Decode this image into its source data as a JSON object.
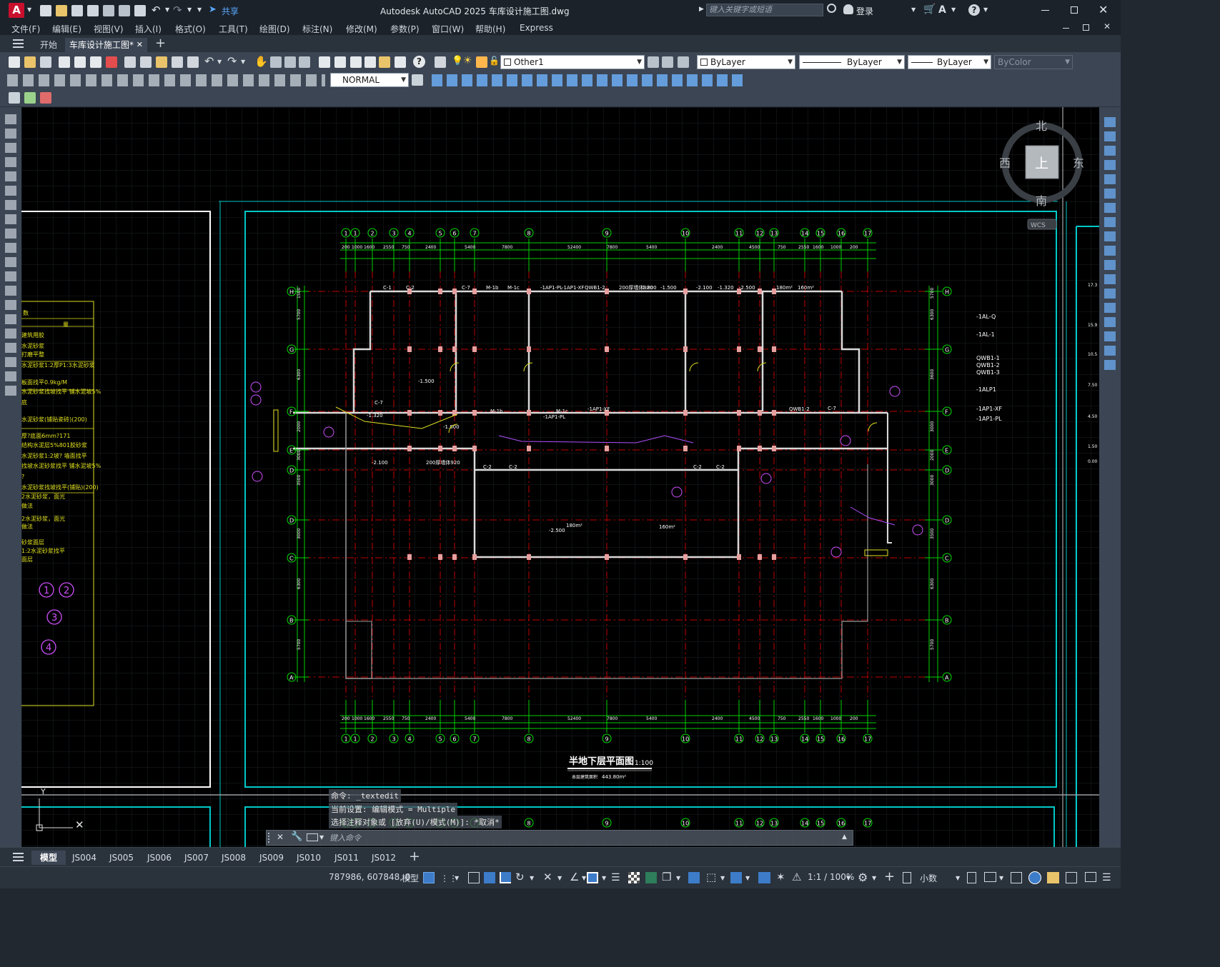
{
  "app": {
    "logo_letter": "A",
    "share_label": "共享",
    "title": "Autodesk AutoCAD 2025    车库设计施工图.dwg",
    "search_placeholder": "键入关键字或短语",
    "login_label": "登录"
  },
  "menus": [
    "文件(F)",
    "编辑(E)",
    "视图(V)",
    "插入(I)",
    "格式(O)",
    "工具(T)",
    "绘图(D)",
    "标注(N)",
    "修改(M)",
    "参数(P)",
    "窗口(W)",
    "帮助(H)",
    "Express"
  ],
  "doc_tabs": {
    "start": "开始",
    "active": "车库设计施工图*"
  },
  "layers": {
    "current_layer": "Other1",
    "color": "ByLayer",
    "linetype": "ByLayer",
    "lineweight": "ByLayer",
    "plotstyle": "ByColor",
    "dimstyle": "NORMAL"
  },
  "viewcube": {
    "north": "北",
    "south": "南",
    "west": "西",
    "east": "东",
    "top": "上",
    "wcs": "WCS"
  },
  "drawing": {
    "title": "半地下层平面图",
    "scale": "1:100",
    "area_label": "本层建筑面积",
    "area_value": "443.80m²",
    "col_axes": [
      "1",
      "1",
      "2",
      "3",
      "4",
      "5",
      "6",
      "7",
      "8",
      "9",
      "10",
      "11",
      "12",
      "13",
      "14",
      "15",
      "16",
      "17"
    ],
    "row_axes": [
      "H",
      "G",
      "F",
      "E",
      "D",
      "D",
      "C",
      "B",
      "A"
    ],
    "top_dims": [
      "200",
      "1000",
      "1600",
      "2550",
      "750",
      "2400",
      "5400",
      "7800",
      "52400",
      "7800",
      "5400",
      "2400",
      "4500",
      "750",
      "2550",
      "1600",
      "1000",
      "200"
    ],
    "bottom_dims": [
      "200",
      "1000",
      "1600",
      "2550",
      "750",
      "2400",
      "5400",
      "7800",
      "52400",
      "7800",
      "5400",
      "2400",
      "4500",
      "750",
      "2550",
      "1600",
      "1000",
      "200"
    ],
    "left_dims": [
      "1500",
      "5700",
      "6300",
      "2000",
      "3000",
      "3500",
      "3000",
      "6300",
      "5700"
    ],
    "right_dims": [
      "5700",
      "6300",
      "3600",
      "3000",
      "2000",
      "3000",
      "3500",
      "6300",
      "5700"
    ],
    "labels": [
      "C-1",
      "C-2",
      "C-7",
      "M-1b",
      "M-1c",
      "-1AP1-PL",
      "-1AP1-XF",
      "QWB1-2",
      "200厚墙体920",
      "-1.800",
      "-1.500",
      "-2.100",
      "-1.320",
      "-2.500",
      "180m²",
      "160m²"
    ],
    "right_legend": [
      "-1AL-Q",
      "-1AL-1",
      "QWB1-1",
      "QWB1-2",
      "QWB1-3",
      "-1ALP1",
      "-1AP1-XF",
      "-1AP1-PL"
    ],
    "partial_left_table": [
      "数",
      "量",
      "建筑用胶",
      "水泥砂浆",
      "打磨平整",
      "水泥砂浆1:2厚P1:3水泥砂浆",
      "板面找平0.9kg/M",
      "水泥砂浆找坡找平 铺水泥坡5%",
      "底",
      "水泥砂浆(铺贴瓷砖)(200)",
      "厚?底面6mm?171",
      "结构水泥层5%801胶砂浆",
      "水泥砂浆1:2坡? 墙面找平",
      "找坡水泥砂浆找平 铺水泥坡5%",
      "?",
      "水泥砂浆找坡找平(铺贴)(200)",
      "2水泥砂浆，面光",
      "做法",
      "2水泥砂浆，面光",
      "做法",
      "砂浆面层",
      "1:2水泥砂浆找平",
      "面层"
    ],
    "partial_left_circles": [
      "1",
      "2",
      "3",
      "4"
    ],
    "right_edge_values": [
      "17.3",
      "15.9",
      "10.5",
      "7.50",
      "4.50",
      "1.50",
      "0.00"
    ]
  },
  "command": {
    "line1": "命令: _textedit",
    "line2": "当前设置: 编辑模式 = Multiple",
    "line3": "选择注释对象或 [放弃(U)/模式(M)]: *取消*",
    "placeholder": "键入命令"
  },
  "layout_tabs": [
    "模型",
    "JS004",
    "JS005",
    "JS006",
    "JS007",
    "JS008",
    "JS009",
    "JS010",
    "JS011",
    "JS012"
  ],
  "status": {
    "coords": "787986, 607848, 0",
    "model": "模型",
    "scale": "1:1 / 100%",
    "units": "小数"
  }
}
